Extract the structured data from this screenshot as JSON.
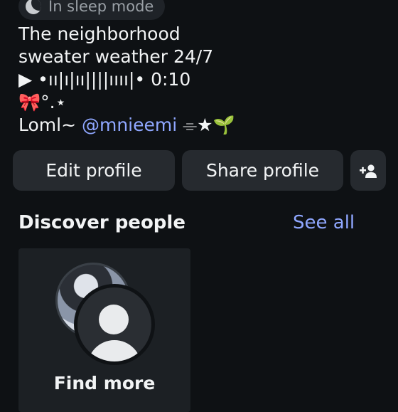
{
  "status": {
    "icon": "moon-icon",
    "text": "In sleep mode"
  },
  "bio": {
    "line1": "The neighborhood",
    "line2": "sweater weather 24/7",
    "line3": "▶ •ıı|ı|ıı||||ıııı|• 0:10",
    "line4": "🎀°.⋆",
    "line5_prefix": "Loml~ ",
    "mention": "@mnieemi",
    "line5_suffix": " ⌯★🌱"
  },
  "buttons": {
    "edit": "Edit profile",
    "share": "Share profile",
    "add_icon": "add-person-icon"
  },
  "discover": {
    "title": "Discover people",
    "see_all": "See all",
    "card_label": "Find more"
  },
  "colors": {
    "background": "#0e1114",
    "accent": "#8fa7ff",
    "button_bg": "#262a2f"
  }
}
